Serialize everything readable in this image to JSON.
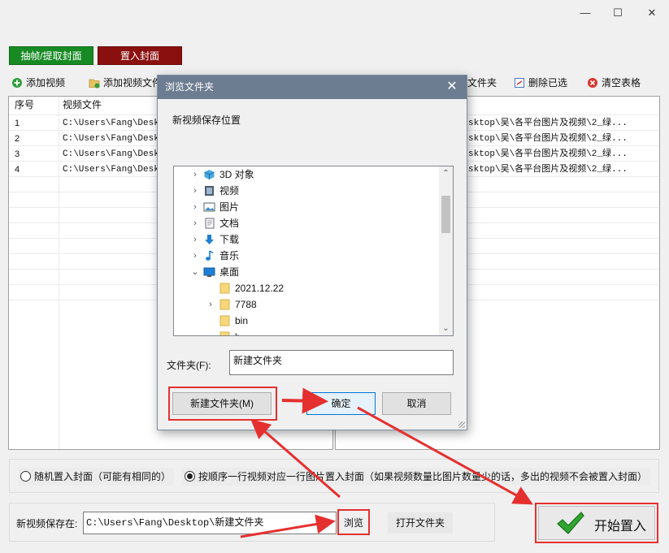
{
  "window": {
    "minimize_glyph": "—",
    "maximize_glyph": "☐",
    "close_glyph": "✕"
  },
  "modes": {
    "extract_label": "抽帧/提取封面",
    "insert_label": "置入封面"
  },
  "toolbar": {
    "add_video": "添加视频",
    "add_video_folder": "添加视频文件",
    "add_image_folder_suffix": "文件夹",
    "delete_selected": "删除已选",
    "clear_table": "清空表格"
  },
  "left_table": {
    "headers": [
      "序号",
      "视频文件"
    ],
    "rows": [
      {
        "no": "1",
        "path": "C:\\Users\\Fang\\Deskt"
      },
      {
        "no": "2",
        "path": "C:\\Users\\Fang\\Deskt"
      },
      {
        "no": "3",
        "path": "C:\\Users\\Fang\\Deskt"
      },
      {
        "no": "4",
        "path": "C:\\Users\\Fang\\Deskt"
      }
    ]
  },
  "right_table": {
    "rows": [
      "sktop\\吴\\各平台图片及视频\\2_绿...",
      "sktop\\吴\\各平台图片及视频\\2_绿...",
      "sktop\\吴\\各平台图片及视频\\2_绿...",
      "sktop\\吴\\各平台图片及视频\\2_绿..."
    ]
  },
  "insert_options": {
    "random_label": "随机置入封面（可能有相同的）",
    "ordered_label": "按顺序一行视频对应一行图片置入封面（如果视频数量比图片数量少的话，多出的视频不会被置入封面）",
    "selected": "ordered"
  },
  "save": {
    "label": "新视频保存在:",
    "path": "C:\\Users\\Fang\\Desktop\\新建文件夹",
    "browse_label": "浏览",
    "open_folder_label": "打开文件夹"
  },
  "start_button": {
    "label": "开始置入"
  },
  "dialog": {
    "title": "浏览文件夹",
    "prompt": "新视频保存位置",
    "tree": [
      {
        "label": "3D 对象",
        "icon": "3d-objects-icon",
        "expander": "›"
      },
      {
        "label": "视频",
        "icon": "videos-folder-icon",
        "expander": "›"
      },
      {
        "label": "图片",
        "icon": "pictures-folder-icon",
        "expander": "›"
      },
      {
        "label": "文档",
        "icon": "documents-folder-icon",
        "expander": "›"
      },
      {
        "label": "下载",
        "icon": "downloads-folder-icon",
        "expander": "›"
      },
      {
        "label": "音乐",
        "icon": "music-folder-icon",
        "expander": "›"
      },
      {
        "label": "桌面",
        "icon": "desktop-folder-icon",
        "expander": "⌄"
      },
      {
        "label": "2021.12.22",
        "icon": "folder-icon",
        "expander": ""
      },
      {
        "label": "7788",
        "icon": "folder-icon",
        "expander": "›"
      },
      {
        "label": "bin",
        "icon": "folder-icon",
        "expander": ""
      },
      {
        "label": "b..",
        "icon": "folder-icon",
        "expander": ""
      }
    ],
    "folder_label": "文件夹(F):",
    "folder_value": "新建文件夹",
    "new_folder_button": "新建文件夹(M)",
    "ok_button": "确定",
    "cancel_button": "取消"
  },
  "colors": {
    "highlight": "#e53030",
    "extract_tab": "#178a24",
    "insert_tab": "#8a1010",
    "dialog_title": "#6d7d91"
  }
}
